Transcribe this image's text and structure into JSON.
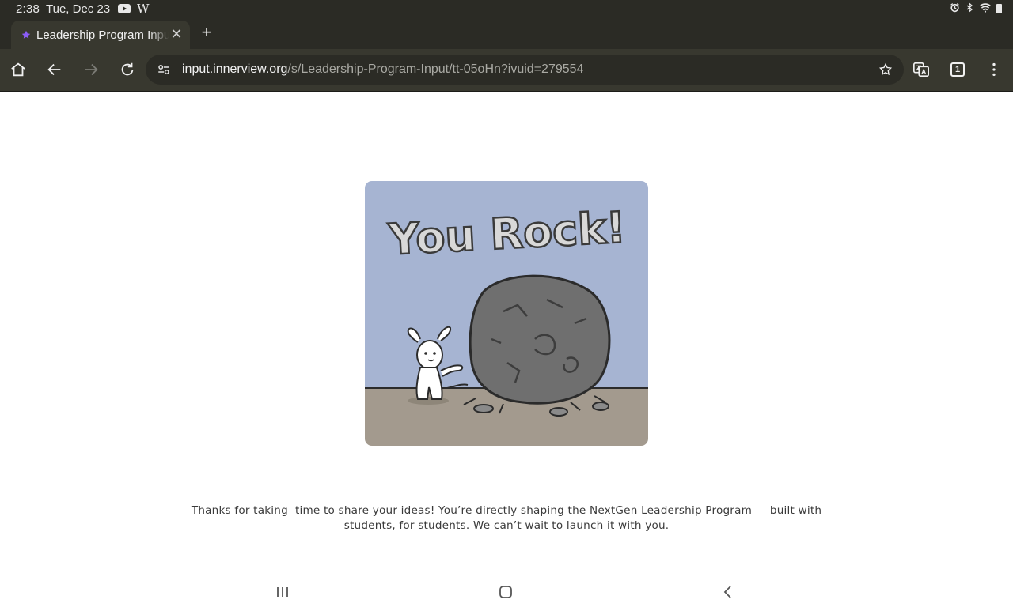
{
  "status_bar": {
    "time": "2:38",
    "date": "Tue, Dec 23",
    "notification_letter": "W",
    "icons": [
      "youtube-icon",
      "alarm-icon",
      "bluetooth-icon",
      "wifi-icon",
      "battery-icon"
    ]
  },
  "browser": {
    "tab": {
      "title": "Leadership Program Input",
      "favicon_color": "#8b5cf6"
    },
    "new_tab_label": "+",
    "tab_count": "1",
    "url": {
      "host": "input.innerview.org",
      "path": "/s/Leadership-Program-Input/tt-05oHn?ivuid=279554"
    }
  },
  "page": {
    "image_caption_text": "You Rock!",
    "message": "Thanks for taking  time to share your ideas! You’re directly shaping the NextGen Leadership Program — built with students, for students. We can’t wait to launch it with you.",
    "colors": {
      "sky": "#a6b4d2",
      "ground": "#a39a8e",
      "rock": "#6f6f6f"
    }
  },
  "nav_bar": {
    "buttons": [
      "recents-button",
      "home-button",
      "back-button"
    ]
  }
}
